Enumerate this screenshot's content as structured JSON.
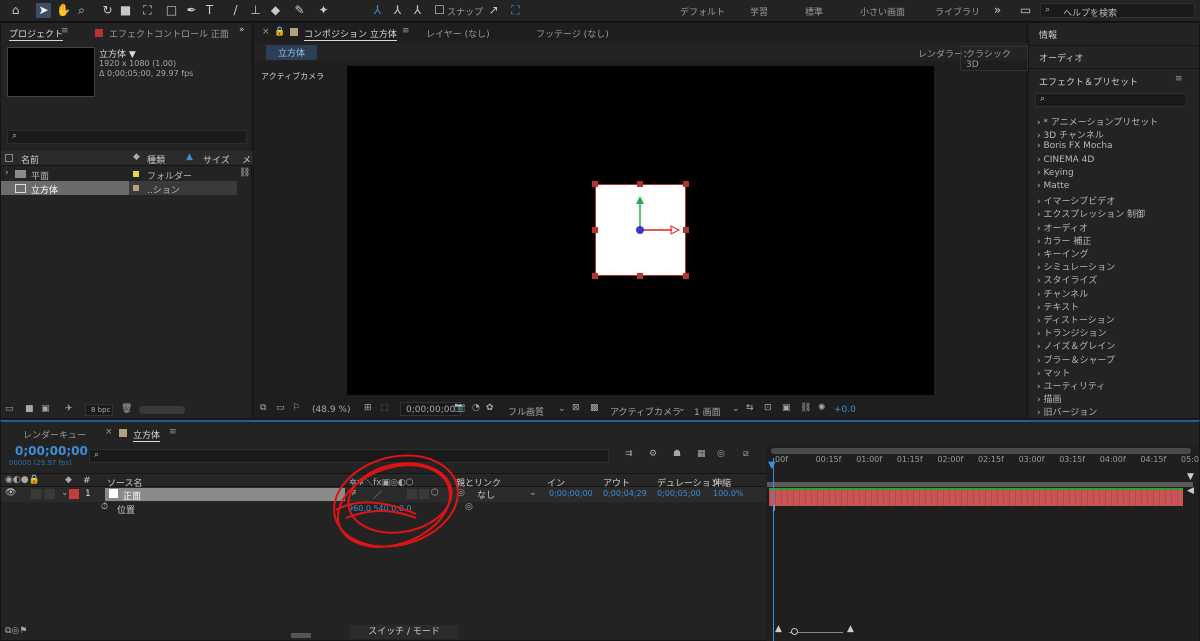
{
  "toolbar": {
    "snap_label": "スナップ",
    "workspaces": [
      "デフォルト",
      "学習",
      "標準",
      "小さい画面",
      "ライブラリ"
    ],
    "help_search": "ヘルプを検索"
  },
  "project": {
    "tab": "プロジェクト",
    "effect_controls_tab": "エフェクトコントロール 正面",
    "item_name": "立方体 ▼",
    "item_res": "1920 x 1080 (1.00)",
    "item_dur": "Δ 0;00;05;00, 29.97 fps",
    "col_name": "名前",
    "col_type": "種類",
    "col_size": "サイズ",
    "col_media": "メ",
    "rows": [
      {
        "name": "平面",
        "type": "フォルダー"
      },
      {
        "name": "立方体",
        "type": "..ション"
      }
    ],
    "bpc": "8 bpc"
  },
  "comp": {
    "tab": "コンポジション 立方体",
    "layer_tab": "レイヤー (なし)",
    "footage_tab": "フッテージ (なし)",
    "subtab": "立方体",
    "renderer_label": "レンダラー：",
    "renderer_value": "クラシック3D",
    "camera": "アクティブカメラ",
    "zoom": "(48.9 %)",
    "timecode": "0;00;00;00",
    "quality": "フル画質",
    "camera_dd": "アクティブカメラ",
    "view": "1 画面",
    "exposure": "+0.0"
  },
  "info": {
    "info": "情報",
    "audio": "オーディオ",
    "effects_title": "エフェクト＆プリセット",
    "items": [
      "* アニメーションプリセット",
      "3D チャンネル",
      "Boris FX Mocha",
      "CINEMA 4D",
      "Keying",
      "Matte",
      "イマーシブビデオ",
      "エクスプレッション 制御",
      "オーディオ",
      "カラー 補正",
      "キーイング",
      "シミュレーション",
      "スタイライズ",
      "チャンネル",
      "テキスト",
      "ディストーション",
      "トランジション",
      "ノイズ＆グレイン",
      "ブラー＆シャープ",
      "マット",
      "ユーティリティ",
      "描画",
      "旧バージョン"
    ]
  },
  "timeline": {
    "render_queue": "レンダーキュー",
    "tab": "立方体",
    "timecode": "0;00;00;00",
    "fps": "00000 (29.97 fps)",
    "col_num": "#",
    "col_source": "ソース名",
    "col_parent": "親とリンク",
    "col_in": "イン",
    "col_out": "アウト",
    "col_dur": "デュレーション",
    "col_stretch": "伸縮",
    "layer_num": "1",
    "layer_name": "正面",
    "parent": "なし",
    "in": "0;00;00;00",
    "out": "0;00;04;29",
    "dur": "0;00;05;00",
    "stretch": "100.0%",
    "prop": "位置",
    "prop_value": "960.0,540.0,0.0",
    "ticks": [
      "00f",
      "00:15f",
      "01:00f",
      "01:15f",
      "02:00f",
      "02:15f",
      "03:00f",
      "03:15f",
      "04:00f",
      "04:15f",
      "05:0"
    ],
    "switch_mode": "スイッチ / モード"
  }
}
